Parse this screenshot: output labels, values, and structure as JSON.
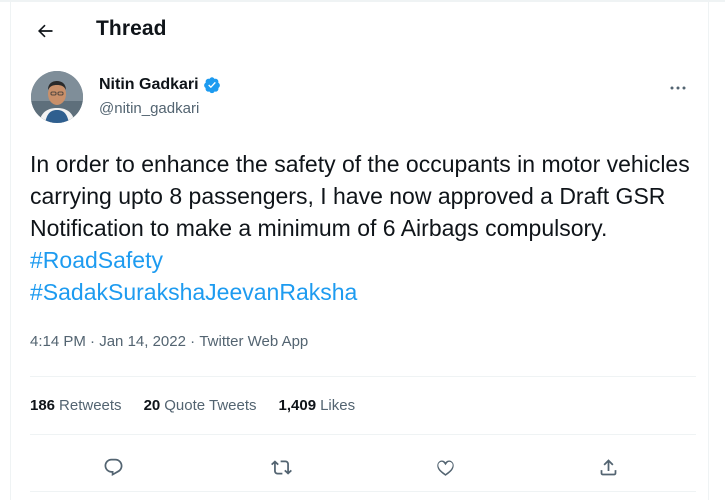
{
  "header": {
    "title": "Thread",
    "back_icon": "arrow-left-icon"
  },
  "author": {
    "name": "Nitin Gadkari",
    "handle": "@nitin_gadkari",
    "verified": true,
    "avatar_icon": "avatar-photo"
  },
  "tweet": {
    "text_plain": "In order to enhance the safety of the occupants in motor vehicles carrying upto 8 passengers, I have now approved a Draft GSR Notification to make a minimum of 6 Airbags compulsory. ",
    "hashtag_1": "#RoadSafety",
    "hashtag_2": "#SadakSurakshaJeevanRaksha"
  },
  "meta": {
    "time": "4:14 PM",
    "separator_1": " · ",
    "date": "Jan 14, 2022",
    "separator_2": " · ",
    "source": "Twitter Web App"
  },
  "stats": {
    "retweets_count": "186",
    "retweets_label": "Retweets",
    "quotes_count": "20",
    "quotes_label": "Quote Tweets",
    "likes_count": "1,409",
    "likes_label": "Likes"
  },
  "actions": {
    "reply_icon": "reply-icon",
    "retweet_icon": "retweet-icon",
    "like_icon": "heart-icon",
    "share_icon": "share-icon"
  },
  "colors": {
    "link": "#1d9bf0",
    "secondary_text": "#536471",
    "primary_text": "#0f1419",
    "divider": "#eff3f4"
  }
}
